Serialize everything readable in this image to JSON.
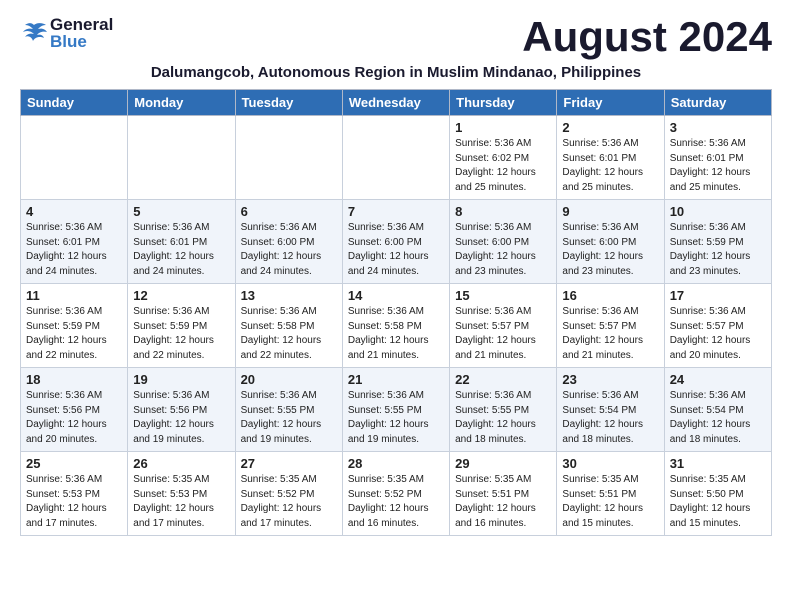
{
  "header": {
    "logo_general": "General",
    "logo_blue": "Blue",
    "month_year": "August 2024",
    "subtitle": "Dalumangcob, Autonomous Region in Muslim Mindanao, Philippines"
  },
  "days_of_week": [
    "Sunday",
    "Monday",
    "Tuesday",
    "Wednesday",
    "Thursday",
    "Friday",
    "Saturday"
  ],
  "weeks": [
    [
      {
        "day": "",
        "info": ""
      },
      {
        "day": "",
        "info": ""
      },
      {
        "day": "",
        "info": ""
      },
      {
        "day": "",
        "info": ""
      },
      {
        "day": "1",
        "info": "Sunrise: 5:36 AM\nSunset: 6:02 PM\nDaylight: 12 hours\nand 25 minutes."
      },
      {
        "day": "2",
        "info": "Sunrise: 5:36 AM\nSunset: 6:01 PM\nDaylight: 12 hours\nand 25 minutes."
      },
      {
        "day": "3",
        "info": "Sunrise: 5:36 AM\nSunset: 6:01 PM\nDaylight: 12 hours\nand 25 minutes."
      }
    ],
    [
      {
        "day": "4",
        "info": "Sunrise: 5:36 AM\nSunset: 6:01 PM\nDaylight: 12 hours\nand 24 minutes."
      },
      {
        "day": "5",
        "info": "Sunrise: 5:36 AM\nSunset: 6:01 PM\nDaylight: 12 hours\nand 24 minutes."
      },
      {
        "day": "6",
        "info": "Sunrise: 5:36 AM\nSunset: 6:00 PM\nDaylight: 12 hours\nand 24 minutes."
      },
      {
        "day": "7",
        "info": "Sunrise: 5:36 AM\nSunset: 6:00 PM\nDaylight: 12 hours\nand 24 minutes."
      },
      {
        "day": "8",
        "info": "Sunrise: 5:36 AM\nSunset: 6:00 PM\nDaylight: 12 hours\nand 23 minutes."
      },
      {
        "day": "9",
        "info": "Sunrise: 5:36 AM\nSunset: 6:00 PM\nDaylight: 12 hours\nand 23 minutes."
      },
      {
        "day": "10",
        "info": "Sunrise: 5:36 AM\nSunset: 5:59 PM\nDaylight: 12 hours\nand 23 minutes."
      }
    ],
    [
      {
        "day": "11",
        "info": "Sunrise: 5:36 AM\nSunset: 5:59 PM\nDaylight: 12 hours\nand 22 minutes."
      },
      {
        "day": "12",
        "info": "Sunrise: 5:36 AM\nSunset: 5:59 PM\nDaylight: 12 hours\nand 22 minutes."
      },
      {
        "day": "13",
        "info": "Sunrise: 5:36 AM\nSunset: 5:58 PM\nDaylight: 12 hours\nand 22 minutes."
      },
      {
        "day": "14",
        "info": "Sunrise: 5:36 AM\nSunset: 5:58 PM\nDaylight: 12 hours\nand 21 minutes."
      },
      {
        "day": "15",
        "info": "Sunrise: 5:36 AM\nSunset: 5:57 PM\nDaylight: 12 hours\nand 21 minutes."
      },
      {
        "day": "16",
        "info": "Sunrise: 5:36 AM\nSunset: 5:57 PM\nDaylight: 12 hours\nand 21 minutes."
      },
      {
        "day": "17",
        "info": "Sunrise: 5:36 AM\nSunset: 5:57 PM\nDaylight: 12 hours\nand 20 minutes."
      }
    ],
    [
      {
        "day": "18",
        "info": "Sunrise: 5:36 AM\nSunset: 5:56 PM\nDaylight: 12 hours\nand 20 minutes."
      },
      {
        "day": "19",
        "info": "Sunrise: 5:36 AM\nSunset: 5:56 PM\nDaylight: 12 hours\nand 19 minutes."
      },
      {
        "day": "20",
        "info": "Sunrise: 5:36 AM\nSunset: 5:55 PM\nDaylight: 12 hours\nand 19 minutes."
      },
      {
        "day": "21",
        "info": "Sunrise: 5:36 AM\nSunset: 5:55 PM\nDaylight: 12 hours\nand 19 minutes."
      },
      {
        "day": "22",
        "info": "Sunrise: 5:36 AM\nSunset: 5:55 PM\nDaylight: 12 hours\nand 18 minutes."
      },
      {
        "day": "23",
        "info": "Sunrise: 5:36 AM\nSunset: 5:54 PM\nDaylight: 12 hours\nand 18 minutes."
      },
      {
        "day": "24",
        "info": "Sunrise: 5:36 AM\nSunset: 5:54 PM\nDaylight: 12 hours\nand 18 minutes."
      }
    ],
    [
      {
        "day": "25",
        "info": "Sunrise: 5:36 AM\nSunset: 5:53 PM\nDaylight: 12 hours\nand 17 minutes."
      },
      {
        "day": "26",
        "info": "Sunrise: 5:35 AM\nSunset: 5:53 PM\nDaylight: 12 hours\nand 17 minutes."
      },
      {
        "day": "27",
        "info": "Sunrise: 5:35 AM\nSunset: 5:52 PM\nDaylight: 12 hours\nand 17 minutes."
      },
      {
        "day": "28",
        "info": "Sunrise: 5:35 AM\nSunset: 5:52 PM\nDaylight: 12 hours\nand 16 minutes."
      },
      {
        "day": "29",
        "info": "Sunrise: 5:35 AM\nSunset: 5:51 PM\nDaylight: 12 hours\nand 16 minutes."
      },
      {
        "day": "30",
        "info": "Sunrise: 5:35 AM\nSunset: 5:51 PM\nDaylight: 12 hours\nand 15 minutes."
      },
      {
        "day": "31",
        "info": "Sunrise: 5:35 AM\nSunset: 5:50 PM\nDaylight: 12 hours\nand 15 minutes."
      }
    ]
  ]
}
